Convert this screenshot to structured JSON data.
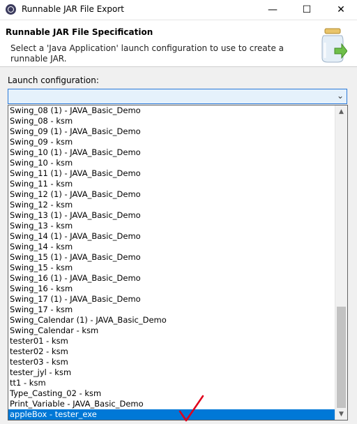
{
  "window": {
    "title": "Runnable JAR File Export",
    "minimize_symbol": "—",
    "maximize_symbol": "☐",
    "close_symbol": "✕"
  },
  "header": {
    "title": "Runnable JAR File Specification",
    "description": "Select a 'Java Application' launch configuration to use to create a runnable JAR."
  },
  "launch_configuration": {
    "label": "Launch configuration:",
    "value": "",
    "arrow_symbol": "⌄"
  },
  "dropdown": {
    "items": [
      "Swing_08 (1) - JAVA_Basic_Demo",
      "Swing_08 - ksm",
      "Swing_09 (1) - JAVA_Basic_Demo",
      "Swing_09 - ksm",
      "Swing_10 (1) - JAVA_Basic_Demo",
      "Swing_10 - ksm",
      "Swing_11 (1) - JAVA_Basic_Demo",
      "Swing_11 - ksm",
      "Swing_12 (1) - JAVA_Basic_Demo",
      "Swing_12 - ksm",
      "Swing_13 (1) - JAVA_Basic_Demo",
      "Swing_13 - ksm",
      "Swing_14 (1) - JAVA_Basic_Demo",
      "Swing_14 - ksm",
      "Swing_15 (1) - JAVA_Basic_Demo",
      "Swing_15 - ksm",
      "Swing_16 (1) - JAVA_Basic_Demo",
      "Swing_16 - ksm",
      "Swing_17 (1) - JAVA_Basic_Demo",
      "Swing_17 - ksm",
      "Swing_Calendar (1) - JAVA_Basic_Demo",
      "Swing_Calendar - ksm",
      "tester01 - ksm",
      "tester02 - ksm",
      "tester03 - ksm",
      "tester_jyl - ksm",
      "tt1 - ksm",
      "Type_Casting_02 - ksm",
      "Print_Variable - JAVA_Basic_Demo",
      "appleBox - tester_exe"
    ],
    "selected_index": 29,
    "scroll_position": 1.0,
    "scroll_up_symbol": "▲",
    "scroll_down_symbol": "▼"
  },
  "colors": {
    "selection": "#0078d7",
    "combo_border": "#2b79d8",
    "annotation_check": "#e0001b"
  }
}
